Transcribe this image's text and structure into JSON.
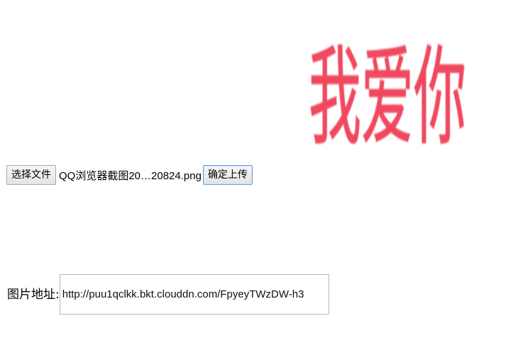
{
  "preview": {
    "text": "我爱你",
    "color": "#f04a5e"
  },
  "upload": {
    "choose_file_label": "选择文件",
    "file_name": "QQ浏览器截图20…20824.png",
    "submit_label": "确定上传"
  },
  "address": {
    "label": "图片地址:",
    "value": "http://puu1qclkk.bkt.clouddn.com/FpyeyTWzDW-h3"
  }
}
